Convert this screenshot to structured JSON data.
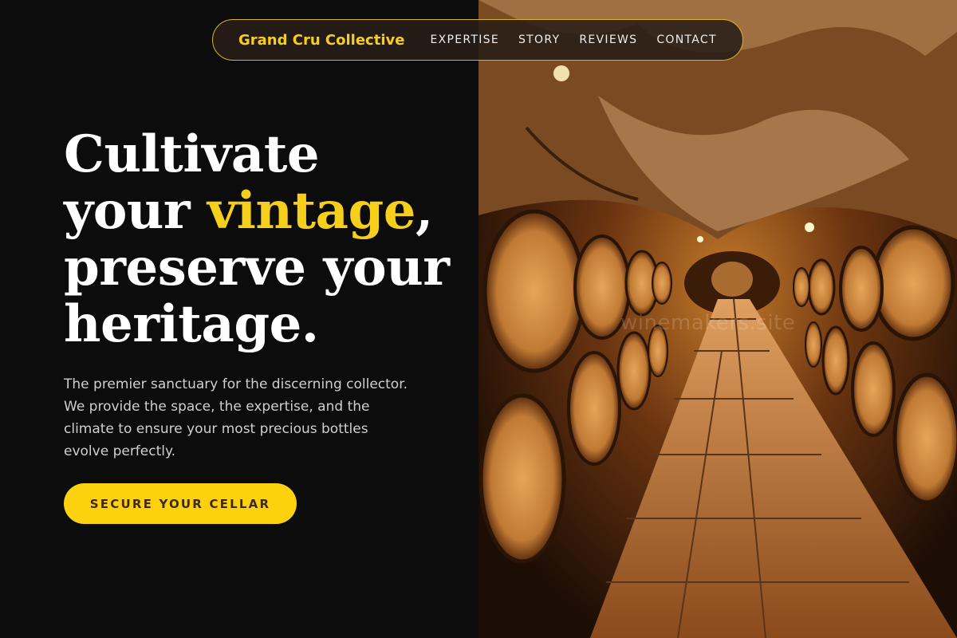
{
  "nav": {
    "brand": "Grand Cru Collective",
    "links": [
      "EXPERTISE",
      "STORY",
      "REVIEWS",
      "CONTACT"
    ]
  },
  "hero": {
    "line1": "Cultivate",
    "line2_pre": "your ",
    "line2_accent": "vintage",
    "line2_post": ",",
    "line3": "preserve your",
    "line4": "heritage.",
    "paragraph": "The premier sanctuary for the discerning collector. We provide the space, the expertise, and the climate to ensure your most precious bottles evolve perfectly.",
    "cta_label": "SECURE YOUR CELLAR"
  },
  "image": {
    "subject": "wine-cellar-barrels-photo",
    "watermark": "winemakers.site"
  },
  "colors": {
    "background": "#0c0c0c",
    "accent": "#f6cf1d",
    "button": "#fdd10e",
    "nav_border": "#d9b21f"
  }
}
